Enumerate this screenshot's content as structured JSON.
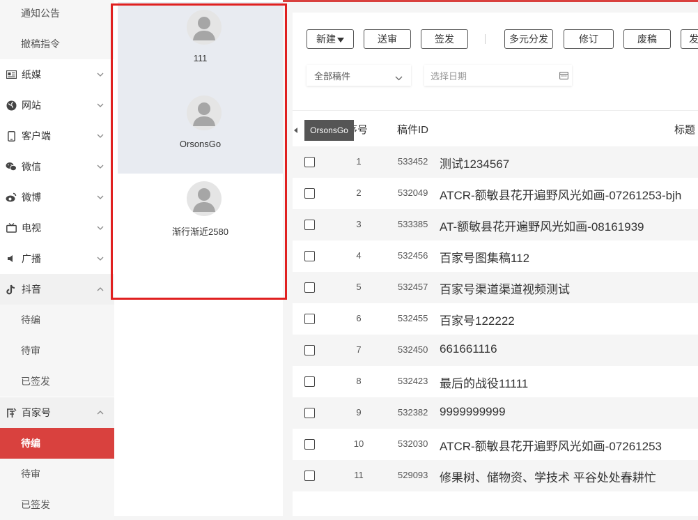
{
  "sidebar": {
    "notice": "通知公告",
    "withdraw": "撤稿指令",
    "paper": "纸媒",
    "website": "网站",
    "client": "客户端",
    "wechat": "微信",
    "weibo": "微博",
    "tv": "电视",
    "radio": "广播",
    "douyin": "抖音",
    "douyin_pending_edit": "待编",
    "douyin_pending_review": "待审",
    "douyin_signed": "已签发",
    "baijia": "百家号",
    "baijia_pending_edit": "待编",
    "baijia_pending_review": "待审",
    "baijia_signed": "已签发"
  },
  "users": [
    {
      "name": "111"
    },
    {
      "name": "OrsonsGo"
    },
    {
      "name": "渐行渐近2580"
    }
  ],
  "toolbar": {
    "new": "新建",
    "submit": "送审",
    "sign": "签发",
    "multi": "多元分发",
    "revise": "修订",
    "discard": "废稿",
    "publish": "发"
  },
  "filters": {
    "type_value": "全部稿件",
    "date_placeholder": "选择日期"
  },
  "table": {
    "col_no": "序号",
    "col_id": "稿件ID",
    "col_title": "标题",
    "rows": [
      {
        "no": "1",
        "id": "533452",
        "title": "测试1234567"
      },
      {
        "no": "2",
        "id": "532049",
        "title": "ATCR-额敏县花开遍野风光如画-07261253-bjh"
      },
      {
        "no": "3",
        "id": "533385",
        "title": "AT-额敏县花开遍野风光如画-08161939"
      },
      {
        "no": "4",
        "id": "532456",
        "title": "百家号图集稿112"
      },
      {
        "no": "5",
        "id": "532457",
        "title": "百家号渠道渠道视频测试"
      },
      {
        "no": "6",
        "id": "532455",
        "title": "百家号122222"
      },
      {
        "no": "7",
        "id": "532450",
        "title": "661661116"
      },
      {
        "no": "8",
        "id": "532423",
        "title": "最后的战役11111"
      },
      {
        "no": "9",
        "id": "532382",
        "title": "9999999999"
      },
      {
        "no": "10",
        "id": "532030",
        "title": "ATCR-额敏县花开遍野风光如画-07261253"
      },
      {
        "no": "11",
        "id": "529093",
        "title": "修果树、储物资、学技术 平谷处处春耕忙"
      }
    ]
  },
  "tooltip": "OrsonsGo",
  "colors": {
    "accent": "#d9413e",
    "highlight_frame": "#e02020",
    "selected_user_bg": "#e8ebf1"
  }
}
